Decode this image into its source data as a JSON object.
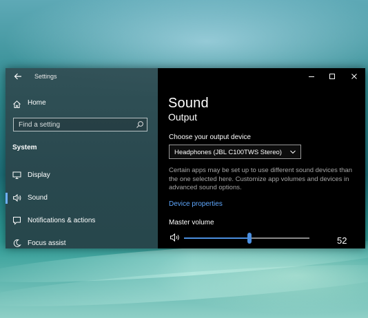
{
  "window": {
    "app_title": "Settings",
    "controls": [
      "minimize-icon",
      "maximize-icon",
      "close-icon"
    ]
  },
  "sidebar": {
    "home_label": "Home",
    "search_placeholder": "Find a setting",
    "section_title": "System",
    "items": [
      {
        "icon": "display-icon",
        "label": "Display",
        "selected": false
      },
      {
        "icon": "speaker-icon",
        "label": "Sound",
        "selected": true
      },
      {
        "icon": "notifications-icon",
        "label": "Notifications & actions",
        "selected": false
      },
      {
        "icon": "moon-icon",
        "label": "Focus assist",
        "selected": false
      }
    ]
  },
  "main": {
    "title": "Sound",
    "subtitle": "Output",
    "output_device_label": "Choose your output device",
    "output_device_value": "Headphones (JBL C100TWS Stereo)",
    "description": "Certain apps may be set up to use different sound devices than the one selected here. Customize app volumes and devices in advanced sound options.",
    "device_properties_link": "Device properties",
    "master_volume_label": "Master volume",
    "master_volume_value": "52",
    "master_volume_level": 0.52
  },
  "colors": {
    "accent": "#4b8fe0",
    "link": "#5fa8ff",
    "sidebar_bg": "#304c52",
    "main_bg": "#000000"
  }
}
